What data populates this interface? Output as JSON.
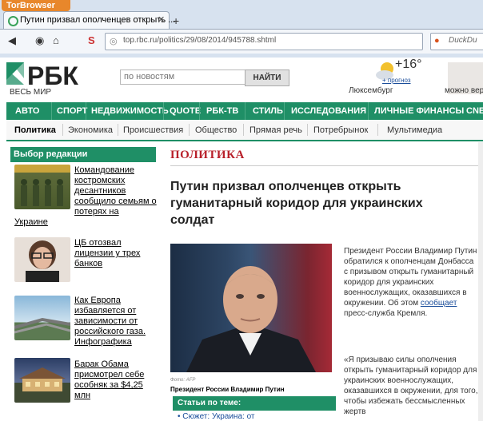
{
  "browser": {
    "app_button": "TorBrowser",
    "tab_title": "Путин призвал ополченцев открыть ...",
    "url": "top.rbc.ru/politics/29/08/2014/945788.shtml",
    "search_placeholder": "DuckDu"
  },
  "header": {
    "logo": "РБК",
    "tagline": "ВЕСЬ МИР",
    "search_placeholder": "по новостям",
    "search_button": "НАЙТИ",
    "weather_temp": "+16°",
    "weather_city": "Люксембург",
    "weather_forecast": "+ прогноз",
    "ad_text": "можно вер"
  },
  "main_nav": [
    "АВТО",
    "СПОРТ",
    "НЕДВИЖИМОСТЬ",
    "QUOTE",
    "РБК-ТВ",
    "СТИЛЬ",
    "ИССЛЕДОВАНИЯ",
    "ЛИЧНЫЕ ФИНАНСЫ",
    "CNEW"
  ],
  "sub_nav": [
    "Политика",
    "Экономика",
    "Происшествия",
    "Общество",
    "Прямая речь",
    "Потребрынок",
    "Мультимедиа"
  ],
  "editors_choice": {
    "title": "Выбор редакции",
    "items": [
      {
        "line1": "Командование",
        "line2": "костромских",
        "line3": "десантников",
        "line4": "сообщило семьям о",
        "line5": "потерях на",
        "line6": "Украине"
      },
      {
        "line1": "ЦБ отозвал",
        "line2": "лицензии у трех",
        "line3": "банков"
      },
      {
        "line1": "Как Европа",
        "line2": "избавляется от",
        "line3": "зависимости от",
        "line4": "российского газа.",
        "line5": "Инфографика"
      },
      {
        "line1": "Барак Обама",
        "line2": "присмотрел себе",
        "line3": "особняк за $4,25",
        "line4": "млн"
      }
    ]
  },
  "article": {
    "rubric": "ПОЛИТИКА",
    "headline": "Путин призвал ополченцев открыть гуманитарный коридор для украинских солдат",
    "photo_credit": "Фото: AFP",
    "photo_caption": "Президент России Владимир Путин",
    "body1_a": "Президент России Владимир Путин обратился к ополченцам Донбасса с призывом открыть гуманитарный коридор для украинских военнослужащих, оказавшихся в окружении. Об этом ",
    "body1_link": "сообщает",
    "body1_b": " пресс-служба Кремля.",
    "body2": "«Я призываю силы ополчения открыть гуманитарный коридор для украинских военнослужащих, оказавшихся в окружении, для того, чтобы избежать бессмысленных жертв",
    "related_title": "Статьи по теме:",
    "related_item": "• Сюжет: Украина: от"
  },
  "colors": {
    "brand_green": "#1f8f66",
    "rubric_red": "#b8202a",
    "link_blue": "#1a4d9a"
  }
}
